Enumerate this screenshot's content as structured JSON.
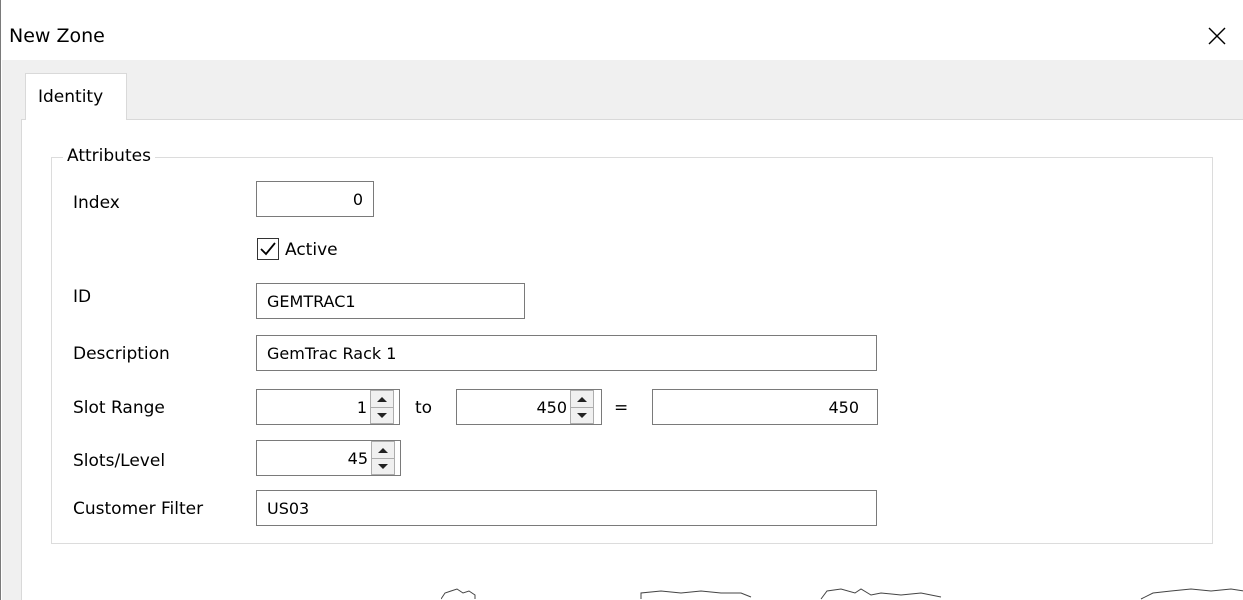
{
  "window": {
    "title": "New Zone",
    "close_icon": "close-icon"
  },
  "tabs": [
    {
      "label": "Identity",
      "selected": true
    }
  ],
  "group": {
    "title": "Attributes"
  },
  "form": {
    "index": {
      "label": "Index",
      "value": "0"
    },
    "active": {
      "label": "Active",
      "checked": true
    },
    "id": {
      "label": "ID",
      "value": "GEMTRAC1"
    },
    "description": {
      "label": "Description",
      "value": "GemTrac Rack 1"
    },
    "slot_range": {
      "label": "Slot Range",
      "from": "1",
      "to_label": "to",
      "to": "450",
      "equals_label": "=",
      "total": "450"
    },
    "slots_per_level": {
      "label": "Slots/Level",
      "value": "45"
    },
    "customer_filter": {
      "label": "Customer Filter",
      "value": "US03"
    }
  },
  "colors": {
    "client_bg": "#f0f0f0",
    "panel_bg": "#ffffff",
    "border": "#7a7a7a"
  }
}
